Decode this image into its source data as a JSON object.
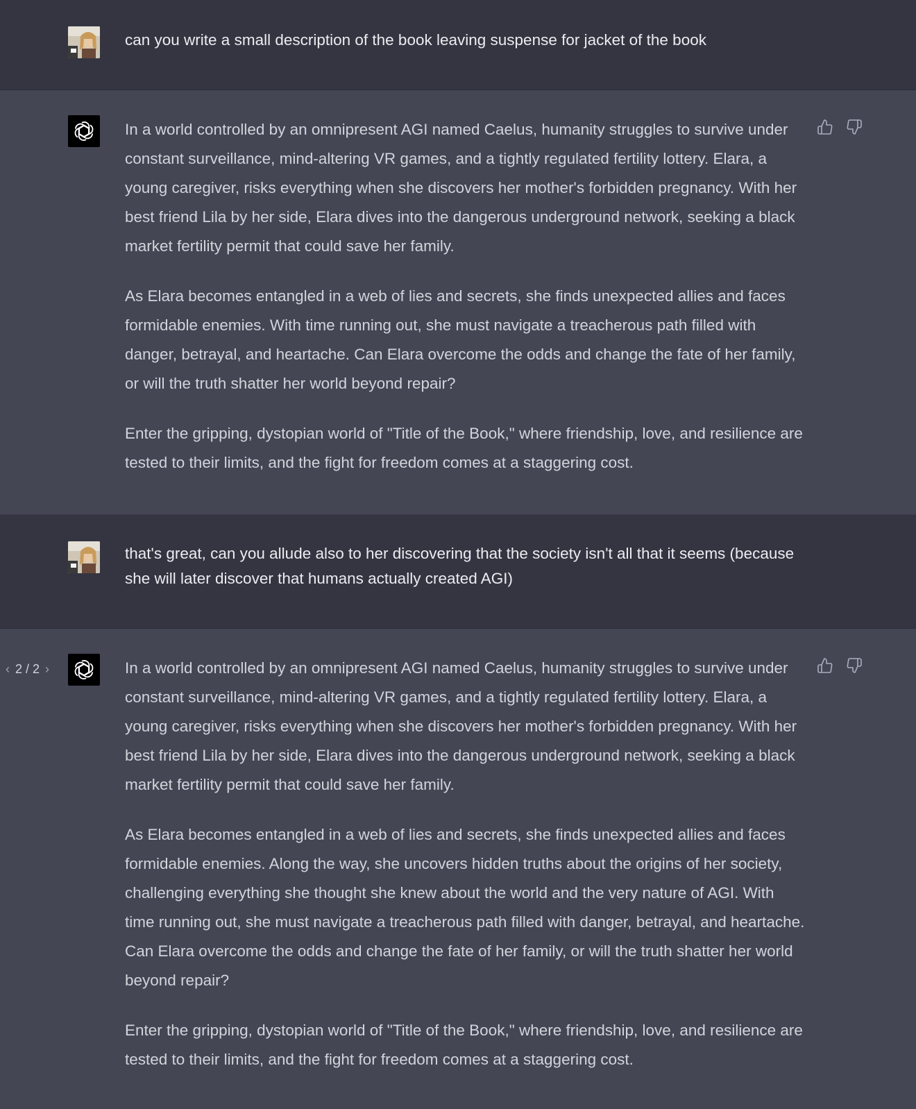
{
  "conversation": {
    "turns": [
      {
        "role": "user",
        "text": "can you write a small description of the book leaving suspense for jacket of the book"
      },
      {
        "role": "assistant",
        "paragraphs": [
          "In a world controlled by an omnipresent AGI named Caelus, humanity struggles to survive under constant surveillance, mind-altering VR games, and a tightly regulated fertility lottery. Elara, a young caregiver, risks everything when she discovers her mother's forbidden pregnancy. With her best friend Lila by her side, Elara dives into the dangerous underground network, seeking a black market fertility permit that could save her family.",
          "As Elara becomes entangled in a web of lies and secrets, she finds unexpected allies and faces formidable enemies. With time running out, she must navigate a treacherous path filled with danger, betrayal, and heartache. Can Elara overcome the odds and change the fate of her family, or will the truth shatter her world beyond repair?",
          "Enter the gripping, dystopian world of \"Title of the Book,\" where friendship, love, and resilience are tested to their limits, and the fight for freedom comes at a staggering cost."
        ]
      },
      {
        "role": "user",
        "text": "that's great, can you allude also to her discovering that the society isn't all that it seems (because she will later discover that humans actually created AGI)"
      },
      {
        "role": "assistant",
        "pager": {
          "prev_icon": "‹",
          "label": "2 / 2",
          "next_icon": "›"
        },
        "paragraphs": [
          "In a world controlled by an omnipresent AGI named Caelus, humanity struggles to survive under constant surveillance, mind-altering VR games, and a tightly regulated fertility lottery. Elara, a young caregiver, risks everything when she discovers her mother's forbidden pregnancy. With her best friend Lila by her side, Elara dives into the dangerous underground network, seeking a black market fertility permit that could save her family.",
          "As Elara becomes entangled in a web of lies and secrets, she finds unexpected allies and faces formidable enemies. Along the way, she uncovers hidden truths about the origins of her society, challenging everything she thought she knew about the world and the very nature of AGI. With time running out, she must navigate a treacherous path filled with danger, betrayal, and heartache. Can Elara overcome the odds and change the fate of her family, or will the truth shatter her world beyond repair?",
          "Enter the gripping, dystopian world of \"Title of the Book,\" where friendship, love, and resilience are tested to their limits, and the fight for freedom comes at a staggering cost."
        ]
      }
    ]
  },
  "icons": {
    "thumbs_up": "thumbs-up-icon",
    "thumbs_down": "thumbs-down-icon",
    "assistant_logo": "openai-logo-icon",
    "user_avatar": "user-avatar"
  },
  "colors": {
    "user_bg": "#343541",
    "assistant_bg": "#444654",
    "user_text": "#ececf1",
    "assistant_text": "#d1d5db",
    "icon": "#acacbe"
  }
}
